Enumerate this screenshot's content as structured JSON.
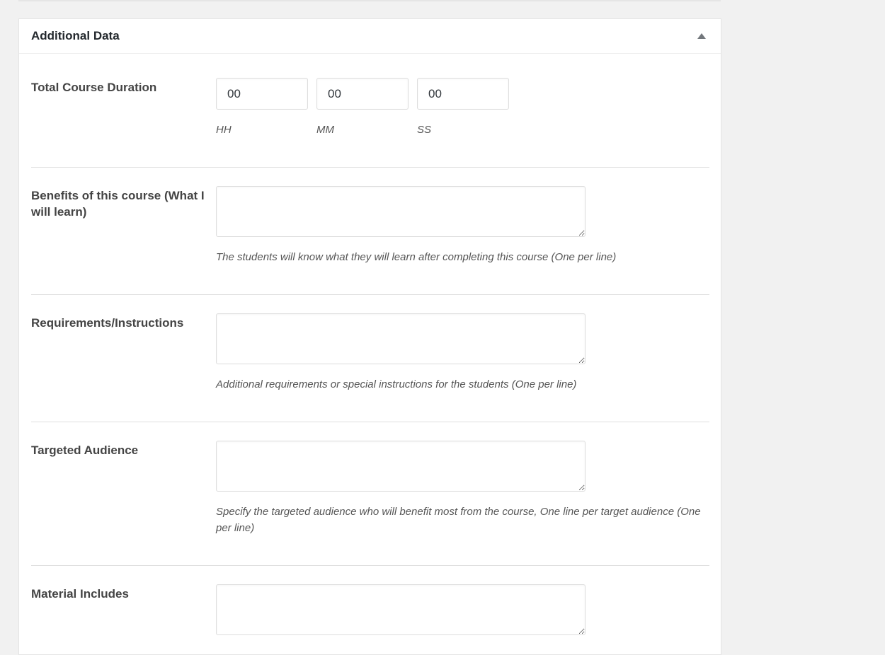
{
  "metabox": {
    "title": "Additional Data",
    "toggle_icon": "triangle-up-icon"
  },
  "duration": {
    "label": "Total Course Duration",
    "hours_value": "00",
    "minutes_value": "00",
    "seconds_value": "00",
    "hours_unit": "HH",
    "minutes_unit": "MM",
    "seconds_unit": "SS"
  },
  "benefits": {
    "label": "Benefits of this course (What I will learn)",
    "value": "",
    "description": "The students will know what they will learn after completing this course (One per line)"
  },
  "requirements": {
    "label": "Requirements/Instructions",
    "value": "",
    "description": "Additional requirements or special instructions for the students (One per line)"
  },
  "audience": {
    "label": "Targeted Audience",
    "value": "",
    "description": "Specify the targeted audience who will benefit most from the course, One line per target audience (One per line)"
  },
  "materials": {
    "label": "Material Includes",
    "value": ""
  }
}
